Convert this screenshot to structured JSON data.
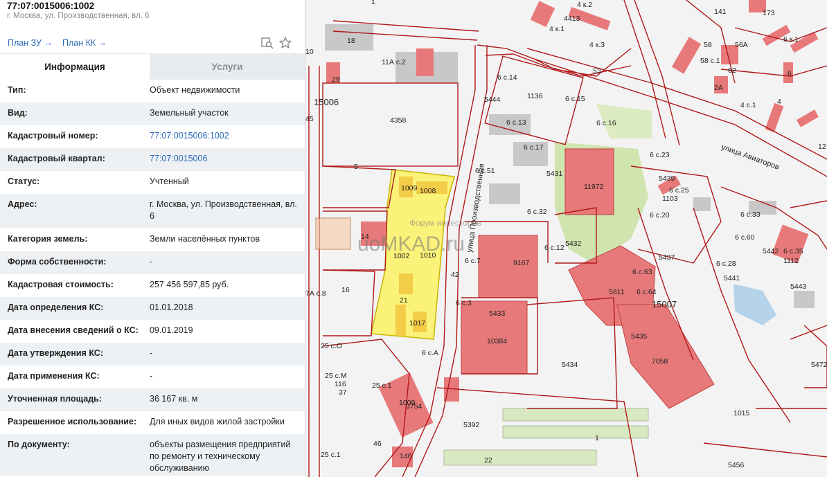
{
  "header": {
    "title": "77:07:0015006:1002",
    "address": "г. Москва, ул. Производственная, вл. 6",
    "link_zu": "План ЗУ →",
    "link_kk": "План КК →"
  },
  "tabs": {
    "info": "Информация",
    "services": "Услуги"
  },
  "details": [
    {
      "label": "Тип:",
      "value": "Объект недвижимости"
    },
    {
      "label": "Вид:",
      "value": "Земельный участок"
    },
    {
      "label": "Кадастровый номер:",
      "value": "77:07:0015006:1002"
    },
    {
      "label": "Кадастровый квартал:",
      "value": "77:07:0015006"
    },
    {
      "label": "Статус:",
      "value": "Учтенный"
    },
    {
      "label": "Адрес:",
      "value": "г. Москва, ул. Производственная, вл. 6"
    },
    {
      "label": "Категория земель:",
      "value": "Земли населённых пунктов"
    },
    {
      "label": "Форма собственности:",
      "value": "-"
    },
    {
      "label": "Кадастровая стоимость:",
      "value": "257 456 597,85 руб."
    },
    {
      "label": "Дата определения КС:",
      "value": "01.01.2018"
    },
    {
      "label": "Дата внесения сведений о КС:",
      "value": "09.01.2019"
    },
    {
      "label": "Дата утверждения КС:",
      "value": "-"
    },
    {
      "label": "Дата применения КС:",
      "value": "-"
    },
    {
      "label": "Уточненная площадь:",
      "value": "36 167 кв. м"
    },
    {
      "label": "Разрешенное использование:",
      "value": "Для иных видов жилой застройки"
    },
    {
      "label": "По документу:",
      "value": "объекты размещения предприятий по ремонту и техническому обслуживанию"
    }
  ],
  "map": {
    "watermark_site": "uoMKAD.ru",
    "watermark_forum": "Форум инвесторов",
    "streets": {
      "proizvodstvennaya": "улица Производственная",
      "aviatorov": "улица Авиаторов"
    },
    "quarters": [
      "15006",
      "15007"
    ],
    "labels": {
      "l1": "1",
      "l4413": "4413",
      "l4k2": "4 к.2",
      "l4k1": "4 к.1",
      "l4k3": "4 к.3",
      "l173": "173",
      "l141": "141",
      "l6k1": "6 к.1",
      "l58": "58",
      "l56a": "56А",
      "l58c1": "58 с.1",
      "l62": "62",
      "l6": "6",
      "l2a": "2А",
      "l4c1": "4 с.1",
      "l4": "4",
      "l12": "12",
      "l10": "10",
      "l18": "18",
      "l11a": "11А с.2",
      "l53": "53",
      "l29": "29",
      "l6c14": "6 с.14",
      "l5444": "5444",
      "l1136": "1136",
      "l6c15": "6 с.15",
      "l4358": "4358",
      "l6c13": "6 с.13",
      "l6c16": "6 с.16",
      "l45": "45",
      "l6c17": "6 с.17",
      "l5": "5",
      "l6c23": "6 с.23",
      "l6c51": "6 с.51",
      "l5431": "5431",
      "l11972": "11972",
      "l5439": "5439",
      "l6c25": "6 с.25",
      "l1009": "1009",
      "l1008": "1008",
      "l6c32": "6 с.32",
      "l1103": "1103",
      "l6c20": "6 с.20",
      "l6c33": "6 с.33",
      "l14": "14",
      "l5432": "5432",
      "l6c12": "6 с.12",
      "l1002": "1002",
      "l1010": "1010",
      "l6c7": "6 с.7",
      "l9167": "9167",
      "l5437": "5437",
      "l6c60": "6 с.60",
      "l5442": "5442",
      "l6c35": "6 с.35",
      "l1112": "1112",
      "l6c63": "6 с.63",
      "l6c28": "6 с.28",
      "l42": "42",
      "l5441": "5441",
      "l7ac8": "7А с.8",
      "l16": "16",
      "l5611": "5611",
      "l6c64": "6 с.64",
      "l5443": "5443",
      "l21": "21",
      "l6c3": "6 с.3",
      "l5433": "5433",
      "l1017": "1017",
      "l10384": "10384",
      "l5435": "5435",
      "l25co": "25 с.О",
      "l6ca": "6 с.А",
      "l7058": "7058",
      "l5472": "5472",
      "l5434": "5434",
      "l25cm": "25 с.М",
      "l116": "116",
      "l25c1": "25 с.1",
      "l37": "37",
      "l3754": "3754",
      "l1015": "1015",
      "l5392": "5392",
      "l46": "46",
      "l25c1b": "25 с.1",
      "l146": "146",
      "l22": "22",
      "l5456": "5456"
    }
  },
  "colors": {
    "link": "#2a6ab7",
    "boundary": "#b01818",
    "building": "#e8797a",
    "highlight": "#fbf27a",
    "greenery": "#c9e0a3",
    "grey_building": "#c8c8c8"
  }
}
